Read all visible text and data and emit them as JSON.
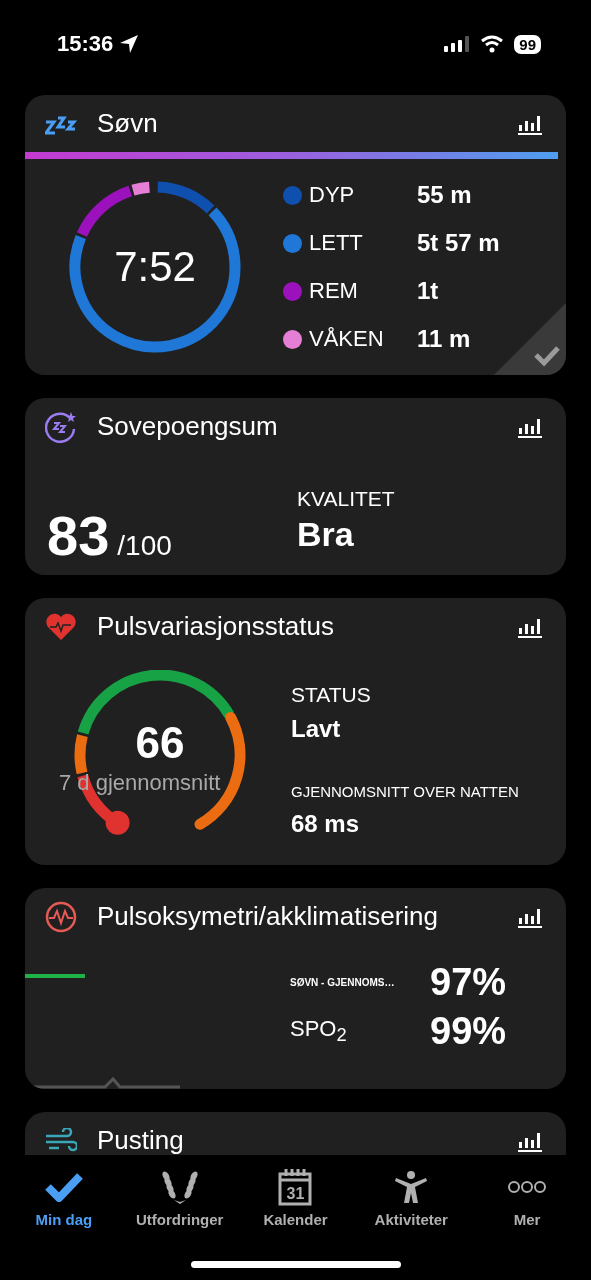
{
  "status_bar": {
    "time": "15:36",
    "battery": "99"
  },
  "sleep": {
    "title": "Søvn",
    "total": "7:52",
    "stages": [
      {
        "label": "DYP",
        "value": "55 m",
        "color": "#0f4fae"
      },
      {
        "label": "LETT",
        "value": "5t 57 m",
        "color": "#1f78d8"
      },
      {
        "label": "REM",
        "value": "1t",
        "color": "#9b12bd"
      },
      {
        "label": "VÅKEN",
        "value": "11 m",
        "color": "#e57fd6"
      }
    ]
  },
  "sleep_score": {
    "title": "Sovepoengsum",
    "score": "83",
    "max": "/100",
    "quality_label": "KVALITET",
    "quality": "Bra"
  },
  "hrv": {
    "title": "Pulsvariasjonsstatus",
    "value": "66",
    "caption": "7 d gjennomsnitt",
    "status_label": "STATUS",
    "status": "Lavt",
    "avg_label": "GJENNOMSNITT OVER NATTEN",
    "avg": "68 ms"
  },
  "pulse_ox": {
    "title": "Pulsoksymetri/akklimatisering",
    "rows": [
      {
        "label": "SØVN - GJENNOMS…",
        "value": "97%",
        "kind": "small"
      },
      {
        "label": "SPO$_{2}$",
        "value": "99%",
        "kind": "large"
      }
    ]
  },
  "breathing": {
    "title": "Pusting"
  },
  "tabs": [
    {
      "label": "Min dag",
      "selected": true
    },
    {
      "label": "Utfordringer",
      "selected": false
    },
    {
      "label": "Kalender",
      "selected": false,
      "date": "31"
    },
    {
      "label": "Aktiviteter",
      "selected": false
    },
    {
      "label": "Mer",
      "selected": false
    }
  ]
}
